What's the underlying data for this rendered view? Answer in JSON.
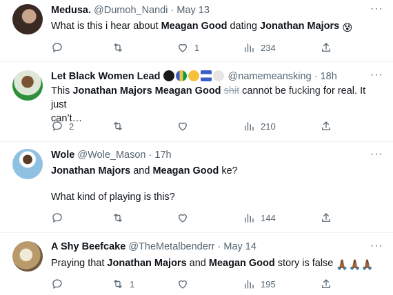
{
  "tweets": [
    {
      "name": "Medusa.",
      "handle": "@Dumoh_Nandi",
      "separator": "·",
      "time": "May 13",
      "text_parts": [
        "What is this i hear about ",
        "Meagan Good",
        " dating ",
        "Jonathan Majors",
        ""
      ],
      "emoji": "😰",
      "replies": "",
      "retweets": "",
      "likes": "1",
      "views": "234",
      "avatar_color": "#3a2a24"
    },
    {
      "name": "Let Black Women Lead",
      "handle": "@namemeansking",
      "separator": "·",
      "time": "18h",
      "text_prefix": "This ",
      "text_bold1": "Jonathan Majors",
      "text_space": " ",
      "text_bold2": "Meagan Good",
      "text_strike": "shit",
      "text_mid": " cannot be ",
      "text_fuzzy": "fucking",
      "text_rest": " for real. It just",
      "text_line2": "can’t…",
      "replies": "2",
      "retweets": "",
      "likes": "",
      "views": "210",
      "avatar_color": "#6b4b2e",
      "flag_colors": [
        "#1a1a1a",
        "#009e49",
        "#f5c13d",
        "#3a5cc7",
        "#e6e6e6"
      ]
    },
    {
      "name": "Wole",
      "handle": "@Wole_Mason",
      "separator": "·",
      "time": "17h",
      "line1_bold1": "Jonathan Majors",
      "line1_mid": " and ",
      "line1_bold2": "Meagan Good",
      "line1_rest": " ke?",
      "line2": "What kind of playing is this?",
      "replies": "",
      "retweets": "",
      "likes": "",
      "views": "144",
      "avatar_color": "#8fc1e3"
    },
    {
      "name": "A Shy Beefcake",
      "handle": "@TheMetalbenderr",
      "separator": "·",
      "time": "May 14",
      "text_prefix": "Praying that ",
      "text_bold1": "Jonathan Majors",
      "text_mid": " and ",
      "text_bold2": "Meagan Good",
      "text_rest": " story is false ",
      "emoji": "🙏🏾🙏🏾🙏🏾",
      "replies": "",
      "retweets": "1",
      "likes": "",
      "views": "195",
      "avatar_color": "#b99a6a"
    }
  ],
  "icons": {
    "more": "more-icon",
    "reply": "reply-icon",
    "retweet": "retweet-icon",
    "like": "heart-icon",
    "views": "views-icon",
    "share": "share-icon"
  },
  "more_glyph": "···"
}
